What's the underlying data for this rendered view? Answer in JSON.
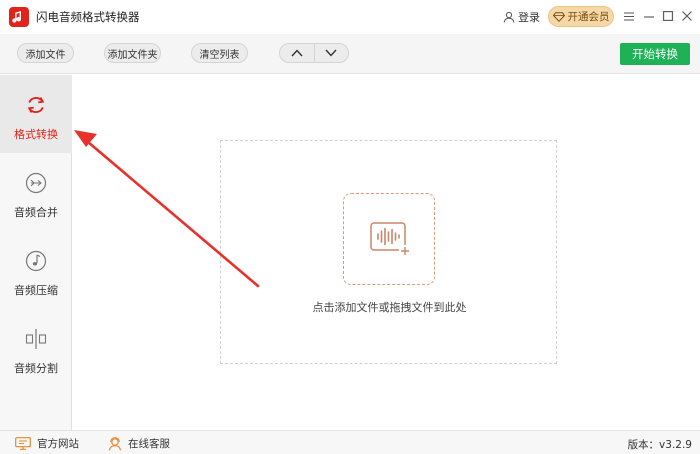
{
  "app": {
    "title": "闪电音频格式转换器",
    "logo_icon": "music-note-icon",
    "brand_color": "#e2231a"
  },
  "header": {
    "login_label": "登录",
    "vip_label": "开通会员"
  },
  "toolbar": {
    "add_file": "添加文件",
    "add_folder": "添加文件夹",
    "clear_list": "清空列表",
    "start_convert": "开始转换",
    "start_color": "#1eb156"
  },
  "sidebar": {
    "items": [
      {
        "label": "格式转换",
        "icon": "refresh-icon",
        "active": true
      },
      {
        "label": "音频合并",
        "icon": "merge-icon",
        "active": false
      },
      {
        "label": "音频压缩",
        "icon": "compress-icon",
        "active": false
      },
      {
        "label": "音频分割",
        "icon": "split-icon",
        "active": false
      }
    ]
  },
  "dropzone": {
    "hint": "点击添加文件或拖拽文件到此处"
  },
  "footer": {
    "website": "官方网站",
    "support": "在线客服",
    "version": "版本：v3.2.9"
  }
}
